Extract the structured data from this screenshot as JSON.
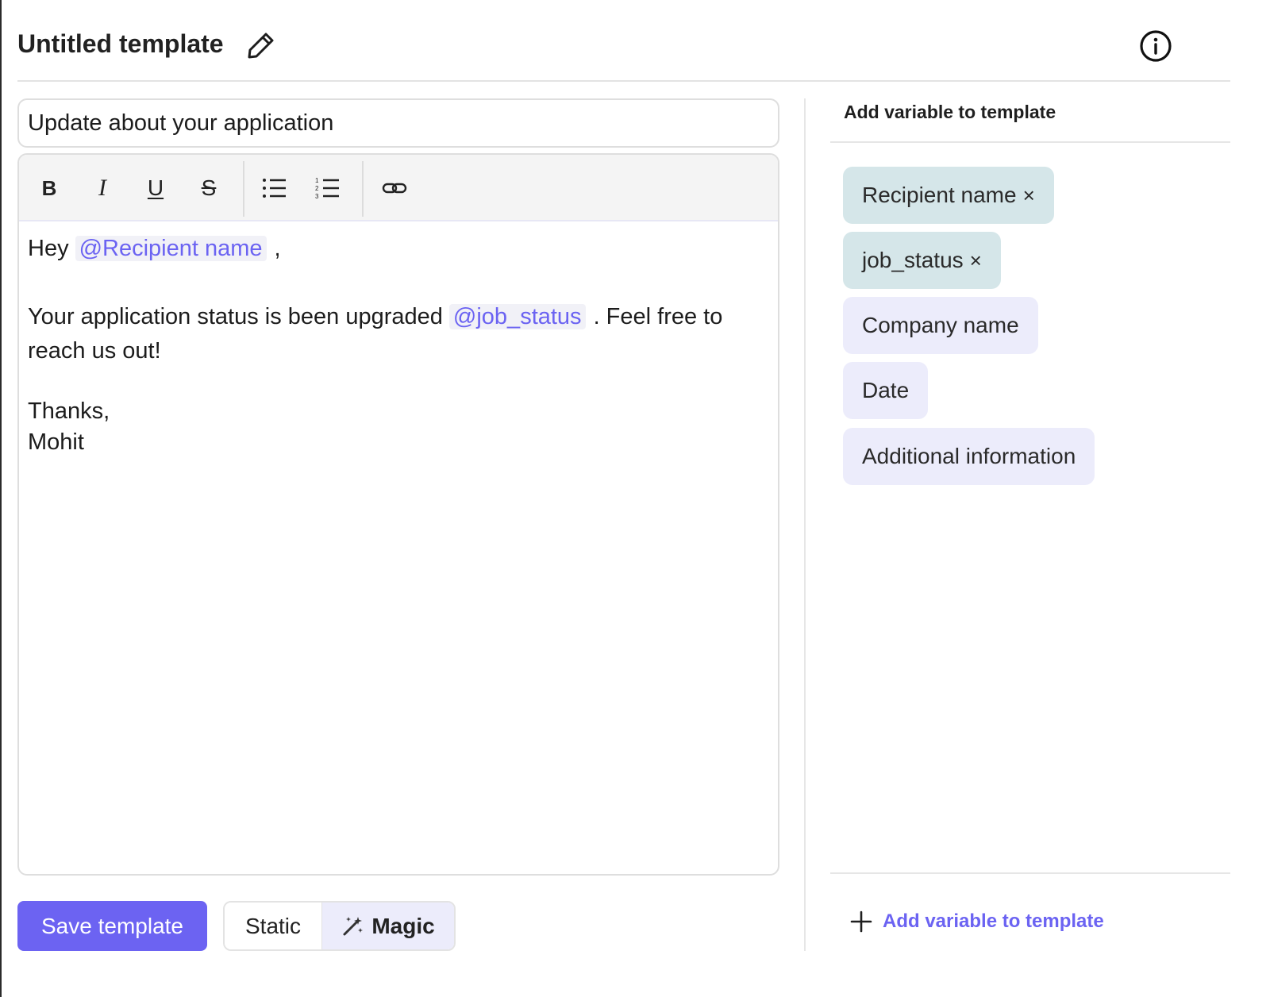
{
  "header": {
    "title": "Untitled template"
  },
  "subject": {
    "value": "Update about your application"
  },
  "toolbar": {
    "bold": "B",
    "italic": "I",
    "underline": "U",
    "strikethrough": "S",
    "icons": [
      "bold-icon",
      "italic-icon",
      "underline-icon",
      "strikethrough-icon",
      "bullet-list-icon",
      "numbered-list-icon",
      "link-icon"
    ]
  },
  "body": {
    "greeting_prefix": "Hey",
    "greeting_mention": "@Recipient name",
    "greeting_suffix": ",",
    "status_prefix": "Your application status is been upgraded",
    "status_mention": "@job_status",
    "status_suffix": ". Feel free to reach us out!",
    "closing": "Thanks,",
    "signature": "Mohit"
  },
  "actions": {
    "save_label": "Save template",
    "mode_static": "Static",
    "mode_magic": "Magic",
    "selected_mode": "Magic"
  },
  "panel": {
    "title": "Add variable to template",
    "variables": [
      {
        "label": "Recipient name",
        "selected": true,
        "remove": "×"
      },
      {
        "label": "job_status",
        "selected": true,
        "remove": "×"
      },
      {
        "label": "Company name",
        "selected": false
      },
      {
        "label": "Date",
        "selected": false
      },
      {
        "label": "Additional information",
        "selected": false
      }
    ],
    "add_label": "Add variable to template"
  },
  "colors": {
    "accent": "#6c63f2",
    "mention_text": "#6b63f2",
    "mention_bg": "#f1f1f7",
    "chip_selected_bg": "#d5e6e9",
    "chip_unselected_bg": "#ececfb",
    "toolbar_bg": "#f4f4f4"
  }
}
